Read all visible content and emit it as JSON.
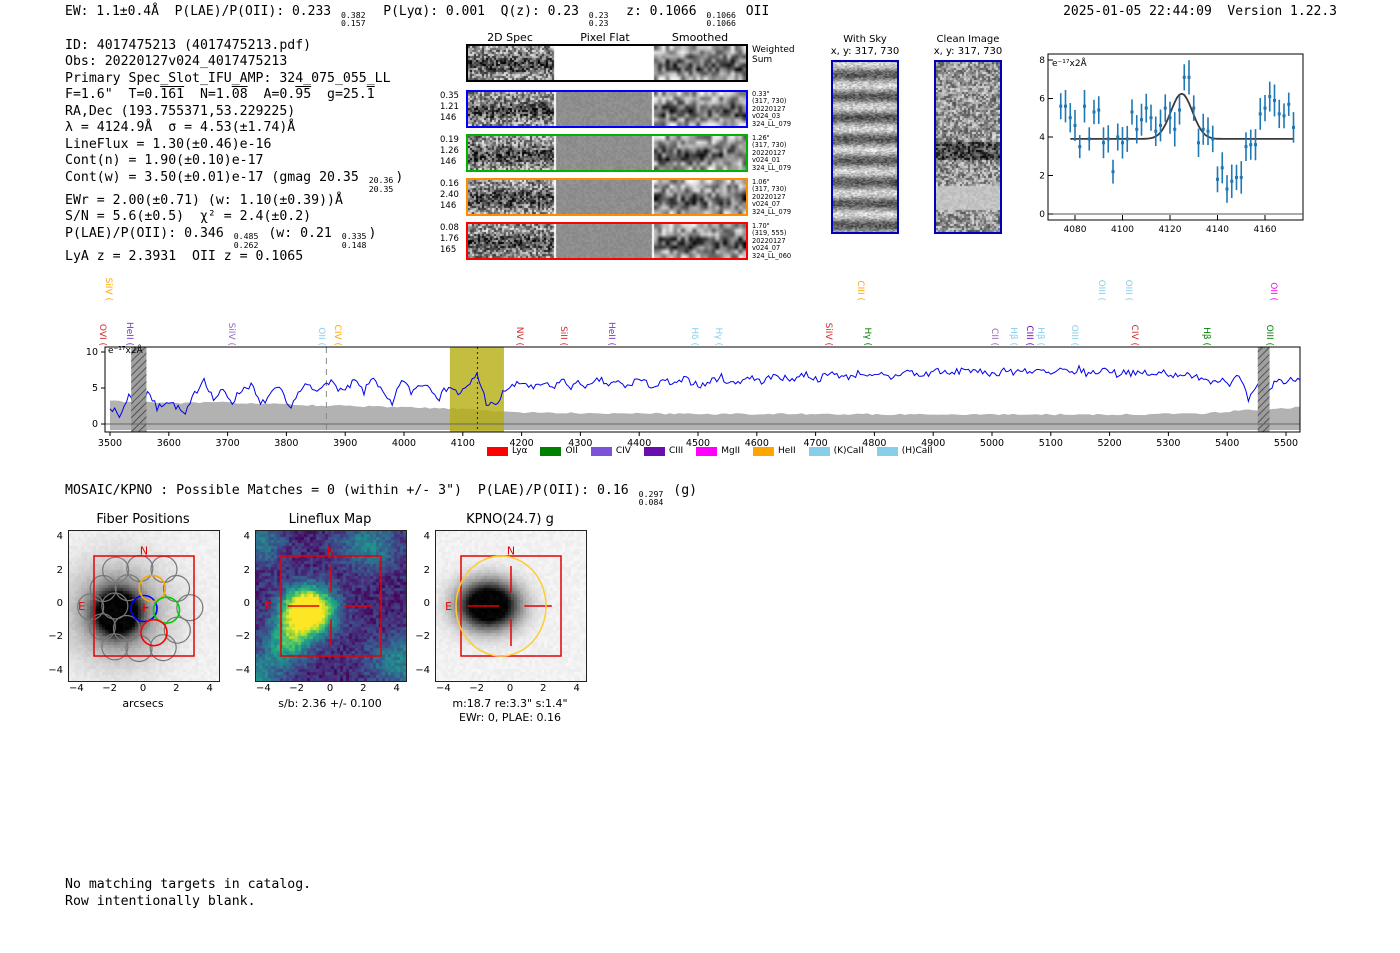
{
  "header": {
    "left": [
      {
        "t": "EW: 1.1±0.4Å  P(LAE)/P(OII): 0.233 "
      },
      {
        "hi": "0.382",
        "lo": "0.157"
      },
      {
        "t": "  P(Lyα): 0.001  Q(z): 0.23 "
      },
      {
        "hi": "0.23",
        "lo": "0.23"
      },
      {
        "t": "  z: 0.1066 "
      },
      {
        "hi": "0.1066",
        "lo": "0.1066"
      },
      {
        "t": " OII"
      }
    ],
    "right": "2025-01-05 22:44:09  Version 1.22.3"
  },
  "info": {
    "lines": [
      [
        {
          "t": "ID: 4017475213 (4017475213.pdf)"
        }
      ],
      [
        {
          "t": "Obs: 20220127v024_4017475213"
        }
      ],
      [
        {
          "t": "Primary Spec_Slot_IFU_AMP: 324_075_055_LL"
        }
      ],
      [
        {
          "t": "F=1.6\"  T=0."
        },
        {
          "t": "161",
          "ov": true
        },
        {
          "t": "  N=1."
        },
        {
          "t": "08",
          "ov": true
        },
        {
          "t": "  A=0."
        },
        {
          "t": "95",
          "ov": true
        },
        {
          "t": "  g=25."
        },
        {
          "t": "1",
          "ov": true
        }
      ],
      [
        {
          "t": "RA,Dec (193.755371,53.229225)"
        }
      ],
      [
        {
          "t": "λ = 4124.9Å  σ = 4.53(±1.74)Å"
        }
      ],
      [
        {
          "t": "LineFlux = 1.30(±0.46)e-16"
        }
      ],
      [
        {
          "t": "Cont(n) = 1.90(±0.10)e-17"
        }
      ],
      [
        {
          "t": "Cont(w) = 3.50(±0.01)e-17 (gmag 20.35 "
        },
        {
          "hi": "20.36",
          "lo": "20.35"
        },
        {
          "t": ")"
        }
      ],
      [
        {
          "t": "EWr = 2.00(±0.71) (w: 1.10(±0.39))Å"
        }
      ],
      [
        {
          "t": "S/N = 5.6(±0.5)  χ² = 2.4(±0.2)"
        }
      ],
      [
        {
          "t": "P(LAE)/P(OII): 0.346 "
        },
        {
          "hi": "0.485",
          "lo": "0.262"
        },
        {
          "t": " (w: 0.21 "
        },
        {
          "hi": "0.335",
          "lo": "0.148"
        },
        {
          "t": ")"
        }
      ],
      [
        {
          "t": "LyA z = 2.3931  OII z = 0.1065"
        }
      ]
    ]
  },
  "spec2d": {
    "col_headers": [
      "2D Spec",
      "Pixel Flat",
      "Smoothed"
    ],
    "rows": [
      {
        "border": "#000000",
        "left": [],
        "right": [
          "Weighted",
          "Sum"
        ],
        "flat": "white"
      },
      {
        "border": "#0000ff",
        "left": [
          "0.35",
          "1.21",
          "146"
        ],
        "right": [
          "0.33\"",
          "(317, 730)",
          "20220127",
          "v024_03",
          "324_LL_079"
        ]
      },
      {
        "border": "#00b300",
        "left": [
          "0.19",
          "1.26",
          "146"
        ],
        "right": [
          "1.26\"",
          "(317, 730)",
          "20220127",
          "v024_01",
          "324_LL_079"
        ]
      },
      {
        "border": "#ff8c00",
        "left": [
          "0.16",
          "2.40",
          "146"
        ],
        "right": [
          "1.06\"",
          "(317, 730)",
          "20220127",
          "v024_07",
          "324_LL_079"
        ]
      },
      {
        "border": "#ff0000",
        "left": [
          "0.08",
          "1.76",
          "165"
        ],
        "right": [
          "1.70\"",
          "(319, 555)",
          "20220127",
          "v024_07",
          "324_LL_060"
        ]
      }
    ]
  },
  "cutouts2d": {
    "with_sky": {
      "title": "With Sky",
      "subtitle": "x, y: 317, 730"
    },
    "clean": {
      "title": "Clean Image",
      "subtitle": "x, y: 317, 730"
    }
  },
  "mosaic_line": [
    {
      "t": "MOSAIC/KPNO : Possible Matches = 0 (within +/- 3\")  P(LAE)/P(OII): 0.16 "
    },
    {
      "hi": "0.297",
      "lo": "0.084"
    },
    {
      "t": " (g)"
    }
  ],
  "footer": {
    "lines": [
      "No matching targets in catalog.",
      "Row intentionally blank."
    ]
  },
  "chart_data": [
    {
      "id": "line_fit_zoom",
      "type": "scatter",
      "title": "emission line fit zoom",
      "ylabel": "e⁻¹⁷x2Å",
      "xlim": [
        4072,
        4176
      ],
      "ylim": [
        -0.5,
        8.4
      ],
      "xticks": [
        4080,
        4100,
        4120,
        4140,
        4160
      ],
      "yticks": [
        0,
        2,
        4,
        6,
        8
      ],
      "x_start": 4074,
      "x_step": 2,
      "y": [
        5.6,
        5.6,
        5.0,
        4.6,
        3.5,
        5.6,
        3.9,
        5.3,
        5.4,
        3.7,
        3.9,
        2.2,
        4.0,
        3.7,
        3.9,
        5.3,
        4.4,
        4.9,
        5.5,
        5.0,
        4.3,
        4.6,
        5.5,
        5.0,
        4.4,
        5.4,
        7.1,
        7.1,
        5.5,
        3.7,
        4.4,
        4.3,
        3.9,
        1.8,
        2.4,
        1.3,
        1.7,
        1.9,
        1.9,
        3.5,
        3.6,
        3.6,
        5.2,
        5.5,
        6.1,
        5.9,
        5.2,
        5.1,
        5.7,
        4.5
      ],
      "yerr": 0.75,
      "fit": {
        "type": "gaussian",
        "mu": 4124.9,
        "sigma": 4.53,
        "amp": 2.35,
        "baseline": 3.9
      },
      "point_color": "#1f77b4",
      "fit_color": "#3a3a3a"
    },
    {
      "id": "full_spectrum",
      "type": "line",
      "title": "full spectrum",
      "ylabel": "e⁻¹⁷x2Å",
      "xlim": [
        3490,
        5524
      ],
      "ylim": [
        -1.2,
        10.6
      ],
      "xticks": [
        3500,
        3600,
        3700,
        3800,
        3900,
        4000,
        4100,
        4200,
        4300,
        4400,
        4500,
        4600,
        4700,
        4800,
        4900,
        5000,
        5100,
        5200,
        5300,
        5400,
        5500
      ],
      "yticks": [
        0,
        5,
        10
      ],
      "x_start": 3500,
      "x_step": 16,
      "y": [
        2.6,
        0.9,
        4.1,
        1.4,
        4.7,
        2.1,
        3.3,
        2.5,
        1.2,
        4.2,
        6.4,
        3.4,
        4.6,
        3.1,
        4.8,
        5.5,
        2.6,
        4.0,
        5.0,
        2.2,
        4.2,
        5.4,
        4.3,
        6.2,
        5.2,
        4.5,
        6.0,
        4.4,
        6.7,
        4.2,
        2.5,
        6.3,
        4.4,
        5.6,
        5.3,
        3.6,
        5.4,
        4.2,
        5.0,
        7.0,
        3.0,
        2.4,
        4.8,
        5.3,
        5.8,
        4.8,
        5.6,
        5.0,
        6.1,
        5.2,
        5.7,
        5.1,
        6.2,
        5.4,
        5.8,
        5.1,
        6.3,
        5.6,
        5.2,
        6.0,
        5.4,
        6.2,
        5.8,
        5.3,
        6.1,
        6.5,
        5.6,
        6.0,
        6.6,
        5.9,
        6.3,
        6.8,
        6.1,
        6.5,
        7.0,
        6.2,
        6.6,
        7.2,
        6.4,
        6.8,
        7.2,
        6.4,
        6.8,
        6.4,
        7.0,
        7.4,
        6.6,
        7.0,
        7.6,
        6.8,
        7.2,
        7.8,
        7.0,
        7.4,
        6.8,
        7.6,
        7.0,
        7.7,
        7.1,
        7.4,
        6.8,
        7.5,
        7.0,
        7.6,
        6.9,
        7.3,
        7.7,
        6.9,
        7.4,
        6.8,
        7.2,
        6.6,
        7.4,
        6.7,
        7.1,
        6.3,
        6.7,
        5.9,
        6.4,
        5.7,
        6.6,
        3.3,
        5.1,
        3.9,
        6.3,
        5.7,
        6.4,
        5.9
      ],
      "err_x": [
        3500,
        3600,
        3700,
        3800,
        3900,
        4000,
        4100,
        4200,
        4400,
        4600,
        4800,
        5000,
        5200,
        5350,
        5450,
        5540
      ],
      "err_y": [
        3.2,
        2.9,
        3.0,
        2.7,
        2.5,
        2.3,
        2.1,
        1.6,
        1.45,
        1.4,
        1.35,
        1.35,
        1.3,
        1.45,
        2.0,
        2.4
      ],
      "line_color": "#0000ee",
      "err_color": "#aaaaaa",
      "band_color": "#b5ae10",
      "bands": [
        {
          "x0": 3536,
          "x1": 3562,
          "style": "hatch"
        },
        {
          "x0": 4078,
          "x1": 4170,
          "style": "olive"
        },
        {
          "x0": 5452,
          "x1": 5472,
          "style": "hatch"
        }
      ],
      "vlines": [
        {
          "x": 3868,
          "style": "dashed"
        },
        {
          "x": 4124.9,
          "style": "dotted"
        }
      ],
      "labels": [
        {
          "text": "OVI (",
          "color": "#d62728",
          "wl": 3502,
          "tier": 0
        },
        {
          "text": "SiIV (",
          "color": "#ffa500",
          "wl": 3512,
          "tier": 1
        },
        {
          "text": "HeII (",
          "color": "#7e2fbe",
          "wl": 3548,
          "tier": 0
        },
        {
          "text": "SiIV (",
          "color": "#9467bd",
          "wl": 3721,
          "tier": 0
        },
        {
          "text": "OII (",
          "color": "#87ceeb",
          "wl": 3874,
          "tier": 0
        },
        {
          "text": "CIV (",
          "color": "#ffa500",
          "wl": 3902,
          "tier": 0
        },
        {
          "text": "NV (",
          "color": "#d62728",
          "wl": 4211,
          "tier": 0
        },
        {
          "text": "SiII (",
          "color": "#d62728",
          "wl": 4286,
          "tier": 0
        },
        {
          "text": "HeII (",
          "color": "#7e2fbe",
          "wl": 4367,
          "tier": 0
        },
        {
          "text": "Hδ (",
          "color": "#87ceeb",
          "wl": 4508,
          "tier": 0
        },
        {
          "text": "Hγ (",
          "color": "#87ceeb",
          "wl": 4549,
          "tier": 0
        },
        {
          "text": "SiIV (",
          "color": "#d62728",
          "wl": 4736,
          "tier": 0
        },
        {
          "text": "CIII (",
          "color": "#ffa500",
          "wl": 4790,
          "tier": 1
        },
        {
          "text": "Hγ (",
          "color": "#008000",
          "wl": 4803,
          "tier": 0
        },
        {
          "text": "CII (",
          "color": "#9467bd",
          "wl": 5019,
          "tier": 0
        },
        {
          "text": "Hβ (",
          "color": "#87ceeb",
          "wl": 5051,
          "tier": 0
        },
        {
          "text": "CIII (",
          "color": "#6a0dad",
          "wl": 5078,
          "tier": 0
        },
        {
          "text": "Hβ (",
          "color": "#87ceeb",
          "wl": 5097,
          "tier": 0
        },
        {
          "text": "OIII (",
          "color": "#87ceeb",
          "wl": 5155,
          "tier": 0
        },
        {
          "text": "OIII (",
          "color": "#87ceeb",
          "wl": 5201,
          "tier": 1
        },
        {
          "text": "OIII (",
          "color": "#87ceeb",
          "wl": 5247,
          "tier": 1
        },
        {
          "text": "CIV (",
          "color": "#d62728",
          "wl": 5257,
          "tier": 0
        },
        {
          "text": "Hβ (",
          "color": "#008000",
          "wl": 5379,
          "tier": 0
        },
        {
          "text": "OIII (",
          "color": "#008000",
          "wl": 5486,
          "tier": 0
        },
        {
          "text": "OII (",
          "color": "#ff00ff",
          "wl": 5494,
          "tier": 1
        }
      ],
      "legend": [
        {
          "label": "Lyα",
          "color": "#ff0000"
        },
        {
          "label": "OII",
          "color": "#008000"
        },
        {
          "label": "CIV",
          "color": "#7c52d8"
        },
        {
          "label": "CIII",
          "color": "#6a0dad"
        },
        {
          "label": "MgII",
          "color": "#ff00ff"
        },
        {
          "label": "HeII",
          "color": "#ffa500"
        },
        {
          "label": "(K)CaII",
          "color": "#87ceeb"
        },
        {
          "label": "(H)CaII",
          "color": "#87ceeb"
        }
      ],
      "legend_position": "bottom"
    },
    {
      "id": "fiber_positions",
      "type": "heatmap",
      "title": "Fiber Positions",
      "xlabel": "arcsecs",
      "ticks": [
        -4,
        -2,
        0,
        2,
        4
      ],
      "north": "N",
      "east": "E",
      "square": [
        -3,
        3
      ],
      "marker": "+",
      "blob": {
        "cx": -1.6,
        "cy": -0.4,
        "sx": 0.85,
        "sy": 0.85
      },
      "fibers": {
        "radius": 0.78,
        "gray": [
          [
            -1.7,
            2.15
          ],
          [
            -0.25,
            2.25
          ],
          [
            1.2,
            2.2
          ],
          [
            -2.45,
            1.05
          ],
          [
            -0.95,
            1.1
          ],
          [
            1.95,
            1.05
          ],
          [
            -3.2,
            -0.05
          ],
          [
            -1.75,
            0.0
          ],
          [
            2.75,
            -0.1
          ],
          [
            -2.5,
            -1.25
          ],
          [
            -1.05,
            -1.35
          ],
          [
            2.0,
            -1.45
          ],
          [
            -1.75,
            -2.45
          ],
          [
            -0.3,
            -2.55
          ],
          [
            1.15,
            -2.5
          ]
        ],
        "colored": [
          {
            "x": 0.0,
            "y": -0.15,
            "c": "#0000ff"
          },
          {
            "x": 0.5,
            "y": 1.05,
            "c": "#ffa500"
          },
          {
            "x": 1.35,
            "y": -0.25,
            "c": "#00cc00"
          },
          {
            "x": 0.6,
            "y": -1.6,
            "c": "#ff0000"
          }
        ]
      }
    },
    {
      "id": "lineflux_map",
      "type": "heatmap",
      "title": "Lineflux Map",
      "xlabel": "s/b: 2.36 +/- 0.100",
      "ticks": [
        -4,
        -2,
        0,
        2,
        4
      ],
      "north": "N",
      "east": "E",
      "square": [
        -3,
        3
      ],
      "crosshair": true,
      "colormap": "viridis",
      "blobs": [
        {
          "cx": -1.4,
          "cy": -0.3,
          "sx": 1.05,
          "sy": 0.95,
          "amp": 1.4
        },
        {
          "cx": -2.6,
          "cy": -2.2,
          "sx": 0.9,
          "sy": 0.9,
          "amp": 0.55
        },
        {
          "cx": 2.2,
          "cy": 3.6,
          "sx": 1.3,
          "sy": 1.0,
          "amp": 0.35
        },
        {
          "cx": 4.2,
          "cy": -3.3,
          "sx": 1.4,
          "sy": 1.1,
          "amp": 0.35
        },
        {
          "cx": -4.2,
          "cy": 3.8,
          "sx": 1.0,
          "sy": 1.0,
          "amp": 0.3
        },
        {
          "cx": -4.4,
          "cy": -4.2,
          "sx": 1.0,
          "sy": 1.0,
          "amp": 0.35
        }
      ]
    },
    {
      "id": "kpno_g",
      "type": "heatmap",
      "title": "KPNO(24.7) g",
      "xlabel": "m:18.7  re:3.3\"  s:1.4\"",
      "xlabel2": "EWr: 0, PLAE: 0.16",
      "ticks": [
        -4,
        -2,
        0,
        2,
        4
      ],
      "north": "N",
      "east": "E",
      "square": [
        -3,
        3
      ],
      "crosshair": true,
      "blob": {
        "cx": -1.35,
        "cy": 0.05,
        "sx": 1.2,
        "sy": 0.95
      },
      "circle": {
        "cx": -0.6,
        "cy": 0.0,
        "rx": 2.7,
        "ry": 3.0,
        "color": "#ffcc33"
      }
    }
  ]
}
